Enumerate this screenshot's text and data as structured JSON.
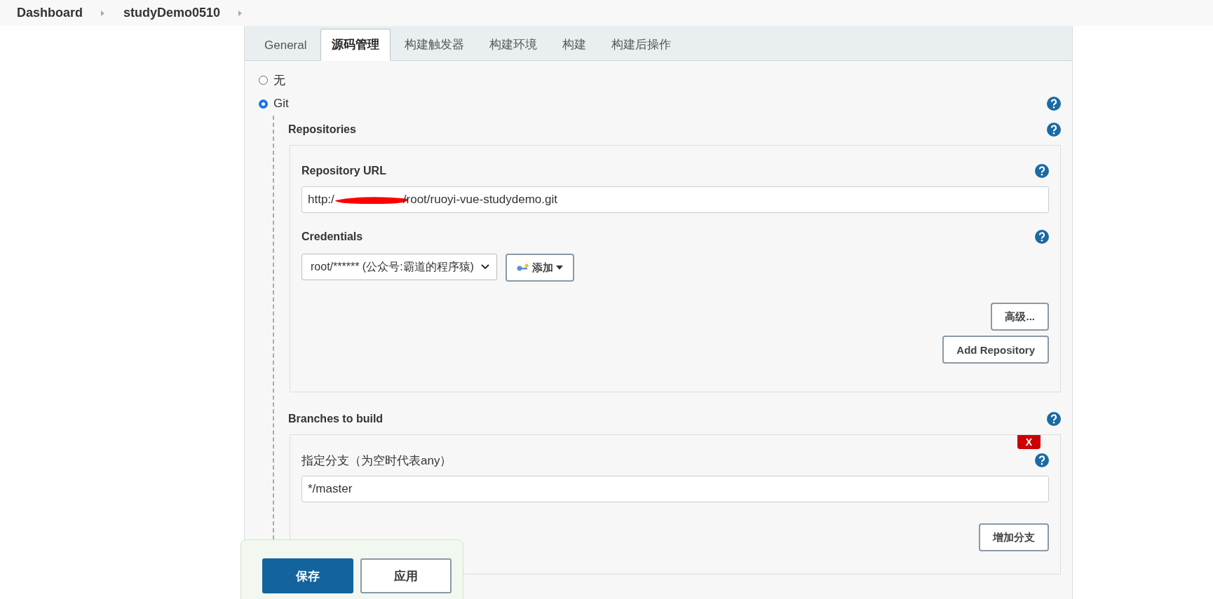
{
  "breadcrumbs": [
    "Dashboard",
    "studyDemo0510"
  ],
  "tabs": [
    {
      "label": "General",
      "selected": false
    },
    {
      "label": "源码管理",
      "selected": true
    },
    {
      "label": "构建触发器",
      "selected": false
    },
    {
      "label": "构建环境",
      "selected": false
    },
    {
      "label": "构建",
      "selected": false
    },
    {
      "label": "构建后操作",
      "selected": false
    }
  ],
  "scm_options": [
    {
      "label": "无",
      "selected": false
    },
    {
      "label": "Git",
      "selected": true
    }
  ],
  "repositories": {
    "title": "Repositories",
    "url_label": "Repository URL",
    "url_visible_start": "http:/",
    "url_visible_end": "/root/ruoyi-vue-studydemo.git",
    "url_redacted": true,
    "credentials_label": "Credentials",
    "credentials_value": "root/****** (公众号:霸道的程序猿)",
    "add_button": "添加",
    "advanced_button": "高级...",
    "add_repository_button": "Add Repository"
  },
  "branches": {
    "title": "Branches to build",
    "delete_button": "X",
    "branch_label": "指定分支（为空时代表any）",
    "branch_value": "*/master",
    "add_branch_button": "增加分支"
  },
  "footer_buttons": [
    {
      "label": "保存",
      "kind": "primary"
    },
    {
      "label": "应用",
      "kind": "secondary"
    }
  ]
}
